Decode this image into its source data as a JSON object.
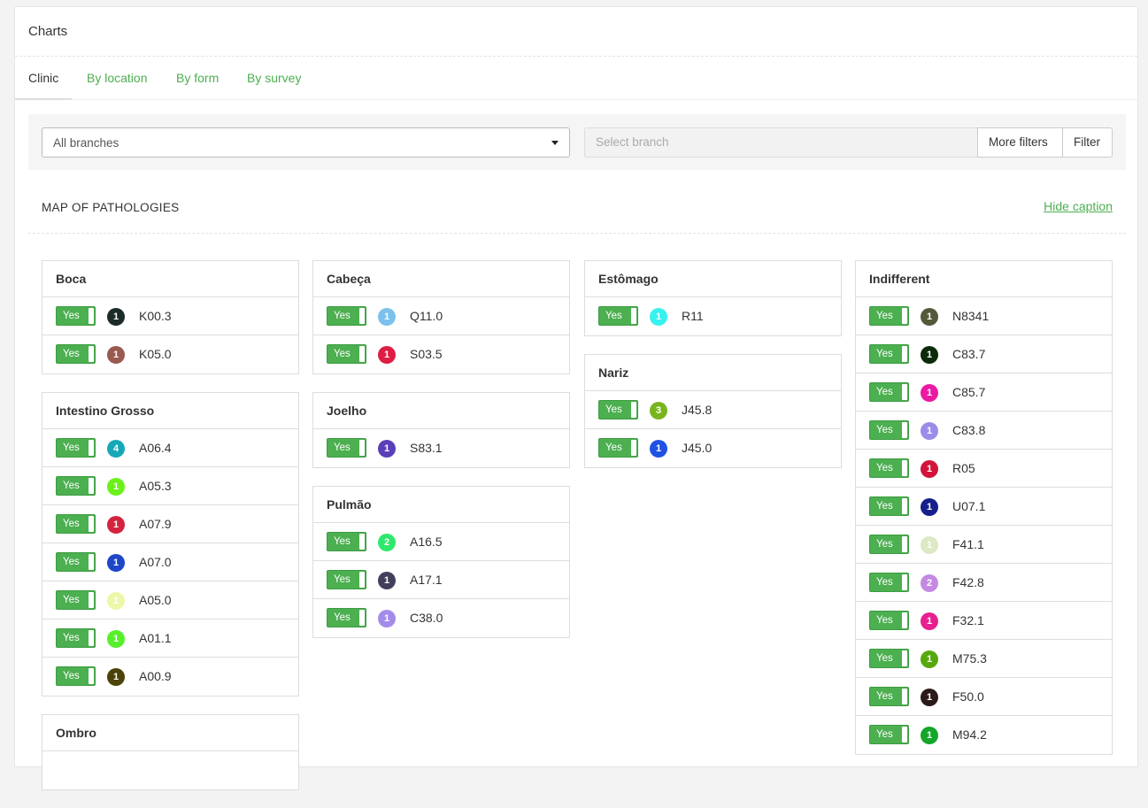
{
  "panel": {
    "title": "Charts"
  },
  "tabs": [
    {
      "label": "Clinic",
      "active": true
    },
    {
      "label": "By location",
      "active": false
    },
    {
      "label": "By form",
      "active": false
    },
    {
      "label": "By survey",
      "active": false
    }
  ],
  "filters": {
    "branch_select_value": "All branches",
    "branch_input_placeholder": "Select branch",
    "more_filters_label": "More filters",
    "filter_label": "Filter"
  },
  "section": {
    "title": "MAP OF PATHOLOGIES",
    "hide_caption_label": "Hide caption"
  },
  "toggle_label": "Yes",
  "columns": [
    [
      {
        "title": "Boca",
        "rows": [
          {
            "count": "1",
            "color": "#1c2a2a",
            "code": "K00.3"
          },
          {
            "count": "1",
            "color": "#9a5a50",
            "code": "K05.0"
          }
        ]
      },
      {
        "title": "Intestino Grosso",
        "rows": [
          {
            "count": "4",
            "color": "#16a8b6",
            "code": "A06.4"
          },
          {
            "count": "1",
            "color": "#6cf01a",
            "code": "A05.3"
          },
          {
            "count": "1",
            "color": "#d4233f",
            "code": "A07.9"
          },
          {
            "count": "1",
            "color": "#1d46c9",
            "code": "A07.0"
          },
          {
            "count": "1",
            "color": "#eef7a8",
            "code": "A05.0"
          },
          {
            "count": "1",
            "color": "#55f02a",
            "code": "A01.1"
          },
          {
            "count": "1",
            "color": "#4b4307",
            "code": "A00.9"
          }
        ]
      },
      {
        "title": "Ombro",
        "rows": []
      }
    ],
    [
      {
        "title": "Cabeça",
        "rows": [
          {
            "count": "1",
            "color": "#7cc1ee",
            "code": "Q11.0"
          },
          {
            "count": "1",
            "color": "#df1d44",
            "code": "S03.5"
          }
        ]
      },
      {
        "title": "Joelho",
        "rows": [
          {
            "count": "1",
            "color": "#5a3fb8",
            "code": "S83.1"
          }
        ]
      },
      {
        "title": "Pulmão",
        "rows": [
          {
            "count": "2",
            "color": "#2ee86d",
            "code": "A16.5"
          },
          {
            "count": "1",
            "color": "#423f5c",
            "code": "A17.1"
          },
          {
            "count": "1",
            "color": "#a38bea",
            "code": "C38.0"
          }
        ]
      }
    ],
    [
      {
        "title": "Estômago",
        "rows": [
          {
            "count": "1",
            "color": "#36f2ee",
            "code": "R11"
          }
        ]
      },
      {
        "title": "Nariz",
        "rows": [
          {
            "count": "3",
            "color": "#79b41e",
            "code": "J45.8"
          },
          {
            "count": "1",
            "color": "#1f52e3",
            "code": "J45.0"
          }
        ]
      }
    ],
    [
      {
        "title": "Indifferent",
        "rows": [
          {
            "count": "1",
            "color": "#525a3a",
            "code": "N8341"
          },
          {
            "count": "1",
            "color": "#0a2a0a",
            "code": "C83.7"
          },
          {
            "count": "1",
            "color": "#ec1aa2",
            "code": "C85.7"
          },
          {
            "count": "1",
            "color": "#9a8de8",
            "code": "C83.8"
          },
          {
            "count": "1",
            "color": "#d3143a",
            "code": "R05"
          },
          {
            "count": "1",
            "color": "#16208a",
            "code": "U07.1"
          },
          {
            "count": "1",
            "color": "#dde8c4",
            "code": "F41.1"
          },
          {
            "count": "2",
            "color": "#c48ae2",
            "code": "F42.8"
          },
          {
            "count": "1",
            "color": "#e8208f",
            "code": "F32.1"
          },
          {
            "count": "1",
            "color": "#56a80e",
            "code": "M75.3"
          },
          {
            "count": "1",
            "color": "#2a1a18",
            "code": "F50.0"
          },
          {
            "count": "1",
            "color": "#14a62a",
            "code": "M94.2"
          }
        ]
      }
    ]
  ]
}
